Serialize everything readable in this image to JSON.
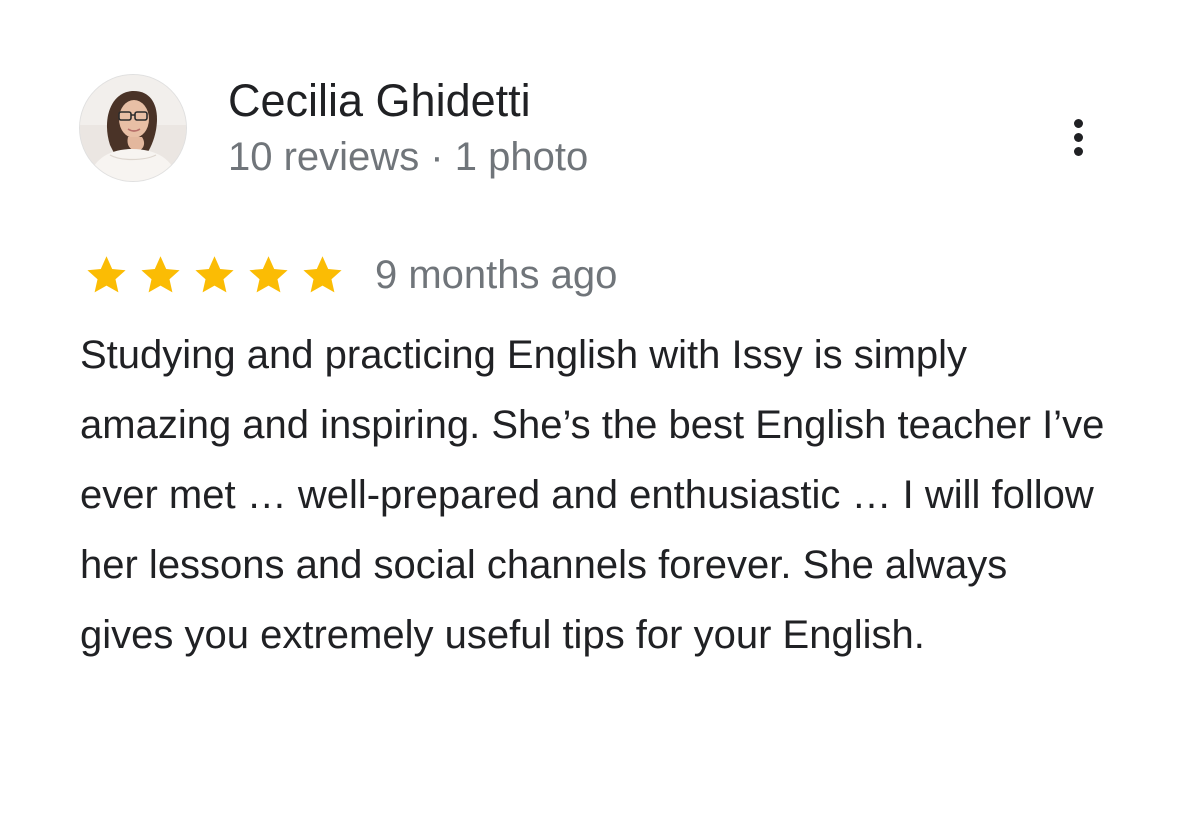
{
  "review": {
    "author_name": "Cecilia Ghidetti",
    "author_meta": "10 reviews · 1 photo",
    "rating": 5,
    "rating_max": 5,
    "date": "9 months ago",
    "text": "Studying and practicing English with Issy is simply amazing and inspiring. She’s the best English teacher I’ve ever met … well-prepared and enthusiastic … I will follow her lessons and social channels forever. She always gives you extremely useful tips for your English."
  },
  "icons": {
    "avatar": "user-avatar-photo",
    "more": "more-vertical-icon",
    "star": "star-icon"
  },
  "colors": {
    "star": "#fbbc04",
    "primary_text": "#202124",
    "secondary_text": "#70757a"
  }
}
